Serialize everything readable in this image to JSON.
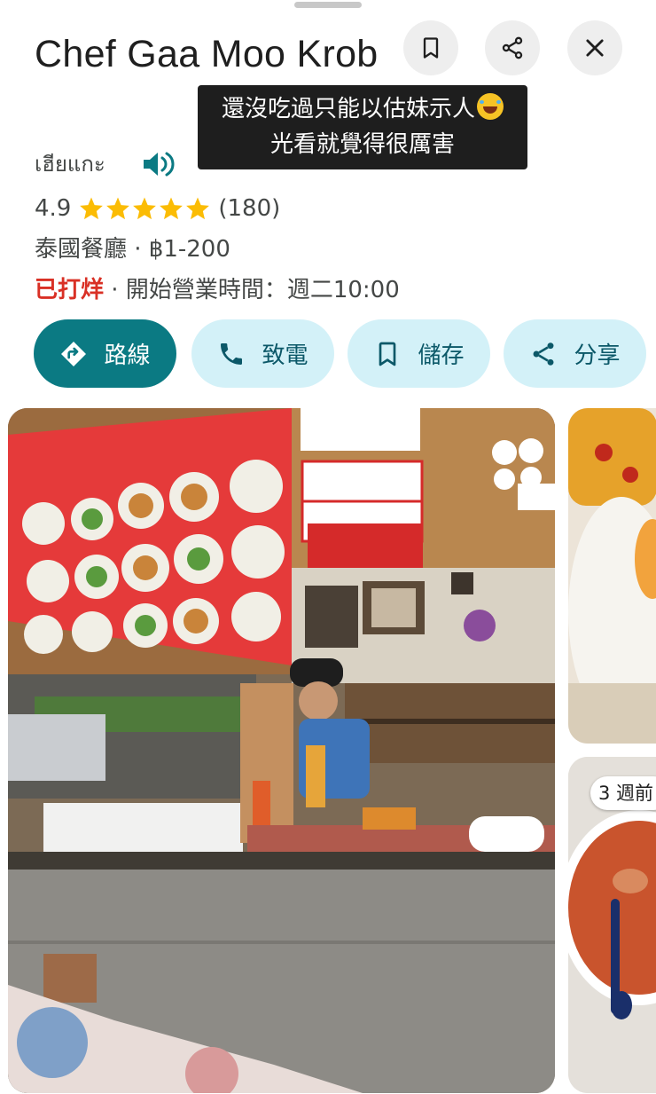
{
  "place": {
    "name": "Chef Gaa Moo Krob",
    "local_name": "เฮียแกะ",
    "rating": "4.9",
    "stars": 5,
    "review_count": "(180)",
    "category_price": "泰國餐廳 · ฿1-200",
    "status": "已打烊",
    "status_separator": " · ",
    "hours": "開始營業時間：週二10:00"
  },
  "caption": {
    "line1": "還沒吃過只能以估妹示人",
    "line2": "光看就覺得很厲害",
    "emoji": "rolling-on-floor-laughing-emoji"
  },
  "header_buttons": {
    "save": "bookmark-icon",
    "share": "share-icon",
    "close": "close-icon"
  },
  "actions": [
    {
      "label": "路線",
      "icon": "directions-icon"
    },
    {
      "label": "致電",
      "icon": "phone-icon"
    },
    {
      "label": "儲存",
      "icon": "bookmark-icon"
    },
    {
      "label": "分享",
      "icon": "share-icon"
    }
  ],
  "photos": {
    "badge": "3 週前"
  },
  "colors": {
    "primary_button": "#0b7a83",
    "tonal_button": "#d3f1f8",
    "tonal_text": "#0b5868",
    "star": "#fbbc04",
    "closed": "#d93025",
    "speaker_icon": "#0b7a83"
  }
}
